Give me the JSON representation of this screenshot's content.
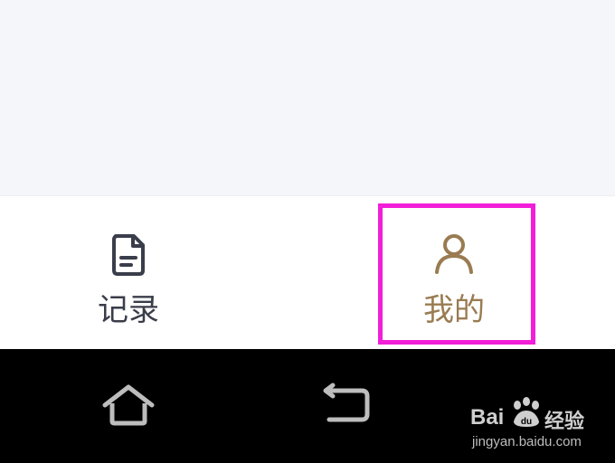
{
  "tab_bar": {
    "tabs": [
      {
        "label": "记录",
        "icon": "document-icon",
        "selected": false,
        "color": "#3a3d4a"
      },
      {
        "label": "我的",
        "icon": "user-icon",
        "selected": true,
        "color": "#9a7b52"
      }
    ]
  },
  "highlight": {
    "color": "#f21ed8"
  },
  "system_nav": {
    "buttons": [
      {
        "icon": "home-icon"
      },
      {
        "icon": "back-icon"
      }
    ]
  },
  "watermark": {
    "brand_left": "Bai",
    "brand_right": "经验",
    "url": "jingyan.baidu.com"
  }
}
